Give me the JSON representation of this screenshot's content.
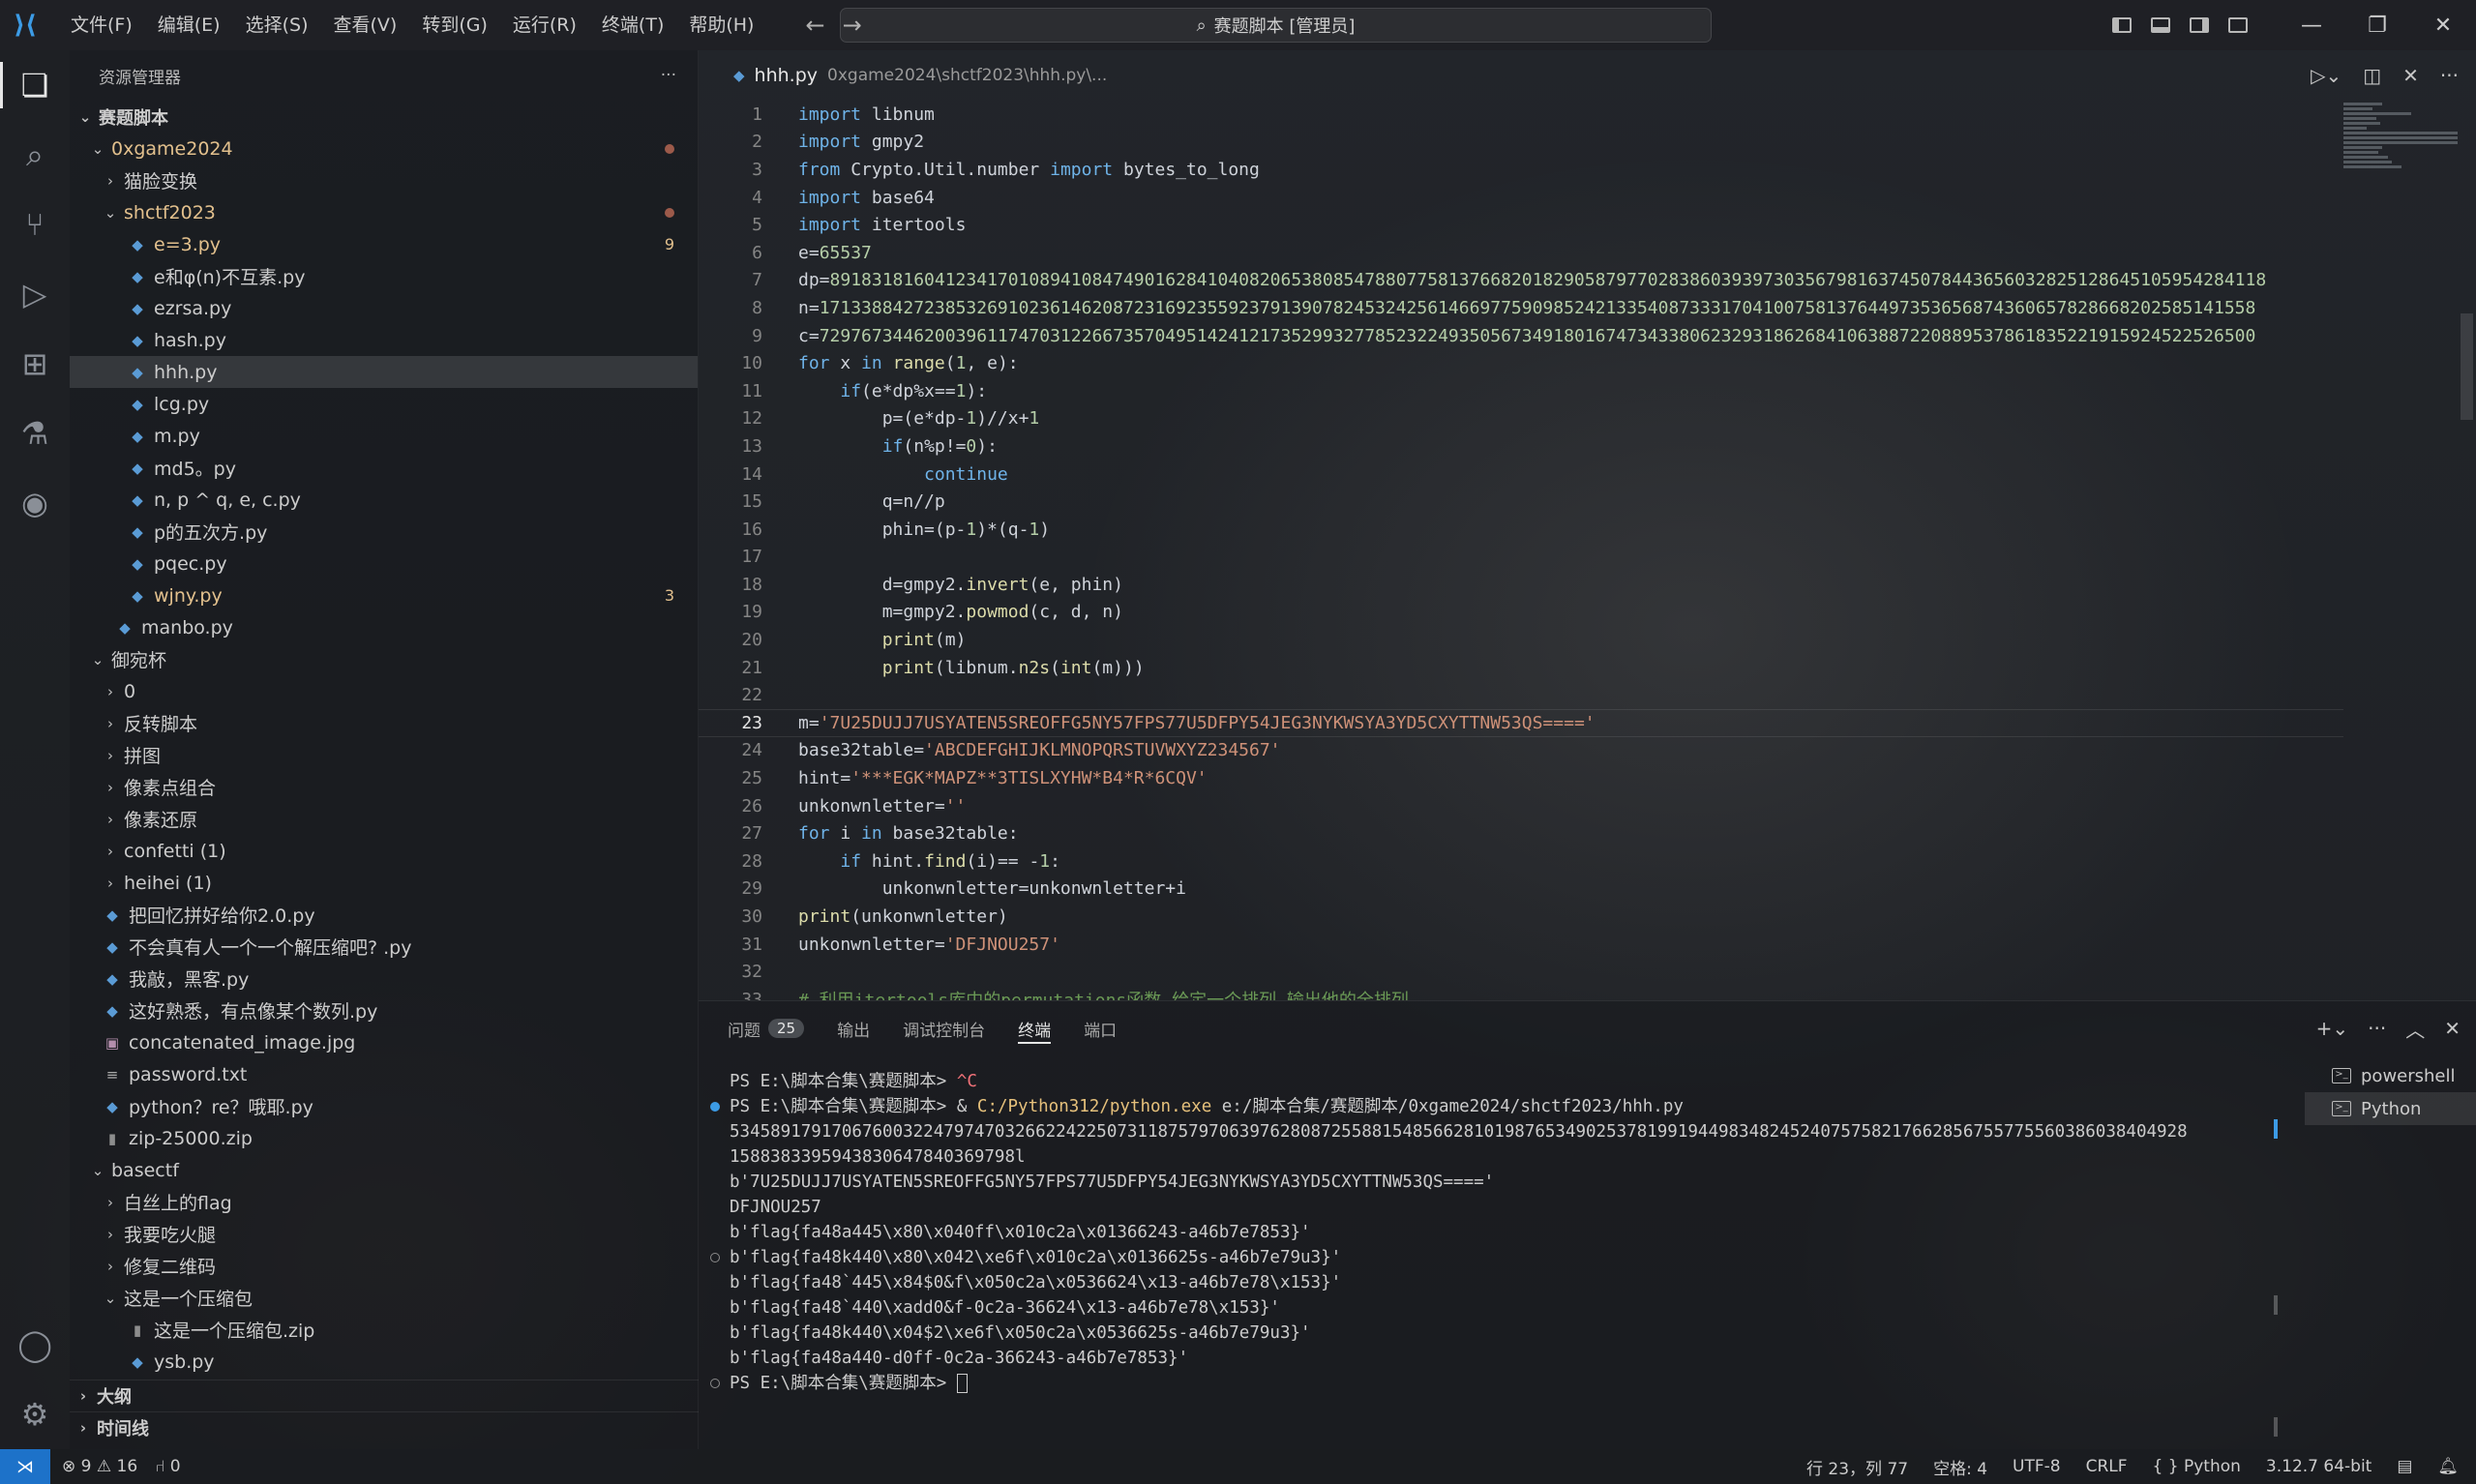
{
  "titlebar": {
    "menu": [
      "文件(F)",
      "编辑(E)",
      "选择(S)",
      "查看(V)",
      "转到(G)",
      "运行(R)",
      "终端(T)",
      "帮助(H)"
    ],
    "search": "赛题脚本 [管理员]"
  },
  "sidebar": {
    "title": "资源管理器",
    "more": "···",
    "tree": [
      {
        "label": "赛题脚本",
        "depth": 0,
        "kind": "folder-open",
        "bold": true
      },
      {
        "label": "0xgame2024",
        "depth": 1,
        "kind": "folder-open",
        "modified": true,
        "dot": true
      },
      {
        "label": "猫脸变换",
        "depth": 2,
        "kind": "folder"
      },
      {
        "label": "shctf2023",
        "depth": 2,
        "kind": "folder-open",
        "modified": true,
        "dot": true
      },
      {
        "label": "e=3.py",
        "depth": 3,
        "kind": "py",
        "modified": true,
        "badge": "9"
      },
      {
        "label": "e和φ(n)不互素.py",
        "depth": 3,
        "kind": "py"
      },
      {
        "label": "ezrsa.py",
        "depth": 3,
        "kind": "py"
      },
      {
        "label": "hash.py",
        "depth": 3,
        "kind": "py"
      },
      {
        "label": "hhh.py",
        "depth": 3,
        "kind": "py",
        "selected": true
      },
      {
        "label": "lcg.py",
        "depth": 3,
        "kind": "py"
      },
      {
        "label": "m.py",
        "depth": 3,
        "kind": "py"
      },
      {
        "label": "md5。py",
        "depth": 3,
        "kind": "py"
      },
      {
        "label": "n, p ^ q, e, c.py",
        "depth": 3,
        "kind": "py"
      },
      {
        "label": "p的五次方.py",
        "depth": 3,
        "kind": "py"
      },
      {
        "label": "pqec.py",
        "depth": 3,
        "kind": "py"
      },
      {
        "label": "wjny.py",
        "depth": 3,
        "kind": "py",
        "modified": true,
        "badge": "3"
      },
      {
        "label": "manbo.py",
        "depth": 2,
        "kind": "py"
      },
      {
        "label": "御宛杯",
        "depth": 1,
        "kind": "folder-open"
      },
      {
        "label": "0",
        "depth": 2,
        "kind": "folder"
      },
      {
        "label": "反转脚本",
        "depth": 2,
        "kind": "folder"
      },
      {
        "label": "拼图",
        "depth": 2,
        "kind": "folder"
      },
      {
        "label": "像素点组合",
        "depth": 2,
        "kind": "folder"
      },
      {
        "label": "像素还原",
        "depth": 2,
        "kind": "folder"
      },
      {
        "label": "confetti (1)",
        "depth": 2,
        "kind": "folder"
      },
      {
        "label": "heihei (1)",
        "depth": 2,
        "kind": "folder"
      },
      {
        "label": "把回忆拼好给你2.0.py",
        "depth": 1,
        "kind": "py"
      },
      {
        "label": "不会真有人一个一个解压缩吧? .py",
        "depth": 1,
        "kind": "py"
      },
      {
        "label": "我敲，黑客.py",
        "depth": 1,
        "kind": "py"
      },
      {
        "label": "这好熟悉，有点像某个数列.py",
        "depth": 1,
        "kind": "py"
      },
      {
        "label": "concatenated_image.jpg",
        "depth": 1,
        "kind": "img"
      },
      {
        "label": "password.txt",
        "depth": 1,
        "kind": "txt"
      },
      {
        "label": "python？re？哦耶.py",
        "depth": 1,
        "kind": "py"
      },
      {
        "label": "zip-25000.zip",
        "depth": 1,
        "kind": "zip"
      },
      {
        "label": "basectf",
        "depth": 1,
        "kind": "folder-open"
      },
      {
        "label": "白丝上的flag",
        "depth": 2,
        "kind": "folder"
      },
      {
        "label": "我要吃火腿",
        "depth": 2,
        "kind": "folder"
      },
      {
        "label": "修复二维码",
        "depth": 2,
        "kind": "folder"
      },
      {
        "label": "这是一个压缩包",
        "depth": 2,
        "kind": "folder-open"
      },
      {
        "label": "这是一个压缩包.zip",
        "depth": 3,
        "kind": "zip"
      },
      {
        "label": "ysb.py",
        "depth": 3,
        "kind": "py"
      }
    ],
    "outline": "大纲",
    "timeline": "时间线"
  },
  "editor": {
    "tab_name": "hhh.py",
    "tab_path": "0xgame2024\\shctf2023\\hhh.py\\...",
    "line_numbers": [
      "1",
      "2",
      "3",
      "4",
      "5",
      "6",
      "7",
      "8",
      "9",
      "10",
      "11",
      "12",
      "13",
      "14",
      "15",
      "16",
      "17",
      "18",
      "19",
      "20",
      "21",
      "22",
      "23",
      "24",
      "25",
      "26",
      "27",
      "28",
      "29",
      "30",
      "31",
      "32",
      "33"
    ],
    "dp_value": "89183181604123417010894108474901628410408206538085478807758137668201829058797702838603939730356798163745078443656032825128645105954284118",
    "n_value": "17133884272385326910236146208723169235592379139078245324256146697759098524213354087333170410075813764497353656874360657828668202585141558",
    "c_value": "72976734462003961174703122667357049514241217352993277852322493505673491801674734338062329318626841063887220889537861835221915924522526500"
  },
  "panel": {
    "tabs": [
      "问题",
      "输出",
      "调试控制台",
      "终端",
      "端口"
    ],
    "problems_count": "25",
    "terminal": {
      "l1": "PS E:\\脚本合集\\赛题脚本> ",
      "l1_ctrl": "^C",
      "l2_prompt": "PS E:\\脚本合集\\赛题脚本> & ",
      "l2_exe": "C:/Python312/python.exe",
      "l2_arg": " e:/脚本合集/赛题脚本/0xgame2024/shctf2023/hhh.py",
      "l3": "53458917917067600322479747032662242250731187579706397628087255881548566281019876534902537819919449834824524075758217662856755775560386038404928",
      "l4": "1588383395943830647840369798l",
      "l5": "b'7U25DUJJ7USYATEN5SREOFFG5NY57FPS77U5DFPY54JEG3NYKWSYA3YD5CXYTTNW53QS===='",
      "l6": "DFJNOU257",
      "l7": "b'flag{fa48a445\\x80\\x040ff\\x010c2a\\x01366243-a46b7e7853}'",
      "l8": "b'flag{fa48k440\\x80\\x042\\xe6f\\x010c2a\\x0136625s-a46b7e79u3}'",
      "l9": "b'flag{fa48`445\\x84$0&f\\x050c2a\\x0536624\\x13-a46b7e78\\x153}'",
      "l10": "b'flag{fa48`440\\xadd0&f-0c2a-36624\\x13-a46b7e78\\x153}'",
      "l11": "b'flag{fa48k440\\x04$2\\xe6f\\x050c2a\\x0536625s-a46b7e79u3}'",
      "l12": "b'flag{fa48a440-d0ff-0c2a-366243-a46b7e7853}'",
      "l13": "PS E:\\脚本合集\\赛题脚本> "
    },
    "terminals": [
      "powershell",
      "Python"
    ]
  },
  "statusbar": {
    "errors": "9",
    "warnings": "16",
    "ports": "0",
    "position": "行 23，列 77",
    "spaces": "空格: 4",
    "encoding": "UTF-8",
    "eol": "CRLF",
    "language": "Python",
    "interpreter": "3.12.7 64-bit"
  }
}
